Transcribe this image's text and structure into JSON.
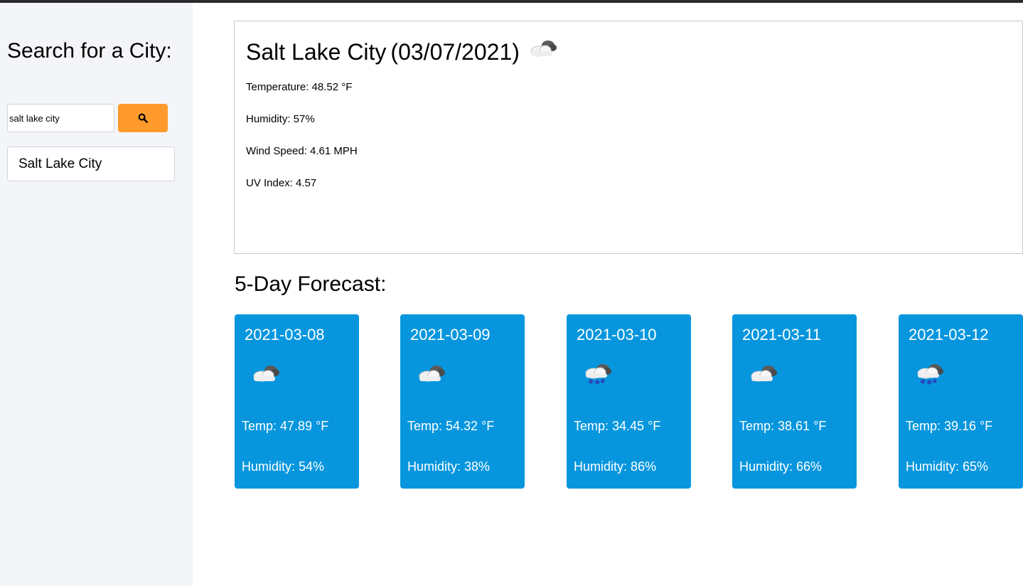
{
  "sidebar": {
    "title": "Search for a City:",
    "search": {
      "value": "salt lake city",
      "button_icon": "search-icon"
    },
    "history": [
      "Salt Lake City"
    ]
  },
  "current": {
    "city": "Salt Lake City",
    "date": "(03/07/2021)",
    "icon": "cloudy-icon",
    "temperature": "Temperature: 48.52 °F",
    "humidity": "Humidity: 57%",
    "wind": "Wind Speed: 4.61 MPH",
    "uv": "UV Index: 4.57"
  },
  "forecast": {
    "title": "5-Day Forecast:",
    "days": [
      {
        "date": "2021-03-08",
        "icon": "cloudy-icon",
        "temp": "Temp: 47.89 °F",
        "humidity": "Humidity: 54%"
      },
      {
        "date": "2021-03-09",
        "icon": "cloudy-icon",
        "temp": "Temp: 54.32 °F",
        "humidity": "Humidity: 38%"
      },
      {
        "date": "2021-03-10",
        "icon": "snow-icon",
        "temp": "Temp: 34.45 °F",
        "humidity": "Humidity: 86%"
      },
      {
        "date": "2021-03-11",
        "icon": "cloudy-icon",
        "temp": "Temp: 38.61 °F",
        "humidity": "Humidity: 66%"
      },
      {
        "date": "2021-03-12",
        "icon": "snow-icon",
        "temp": "Temp: 39.16 °F",
        "humidity": "Humidity: 65%"
      }
    ]
  },
  "colors": {
    "accent_button": "#ff9b2c",
    "forecast_card": "#0796de",
    "sidebar_bg": "#f4f5f9"
  }
}
